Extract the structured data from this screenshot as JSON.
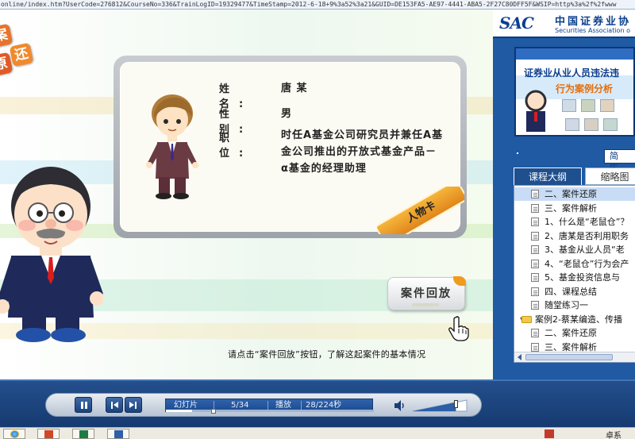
{
  "browser": {
    "url": "online/index.htm?UserCode=276812&CourseNo=336&TrainLogID=19329477&TimeStamp=2012-6-18+9%3a52%3a21&GUID=DE153FA5-AE97-4441-ABA5-2F27C80DFF5F&WSIP=http%3a%2f%2fwww"
  },
  "badge": {
    "chars": [
      "案",
      "原",
      "还"
    ]
  },
  "profile": {
    "name_label": "姓 名:",
    "name_value": "唐 某",
    "gender_label": "性 别:",
    "gender_value": "男",
    "position_label": "职 位:",
    "position_value": "时任A基金公司研究员并兼任A基金公司推出的开放式基金产品－α基金的经理助理",
    "ribbon": "人物卡"
  },
  "replay_button": "案件回放",
  "instruction": "请点击“案件回放”按钮，了解这起案件的基本情况",
  "sidebar": {
    "org_logo": "SAC",
    "org_name_cn": "中国证券业协",
    "org_name_en": "Securities Association o",
    "thumb_title": "证券业从业人员违法违",
    "thumb_subtitle": "行为案例分析",
    "simple_button": "简 历",
    "tabs": [
      "课程大纲",
      "缩略图"
    ],
    "outline": [
      {
        "label": "二、案件还原",
        "icon": "doc-icon",
        "indent": 1,
        "selected": true
      },
      {
        "label": "三、案件解析",
        "icon": "doc-icon",
        "indent": 1
      },
      {
        "label": "1、什么是“老鼠仓”？",
        "icon": "doc-icon",
        "indent": 1
      },
      {
        "label": "2、唐某是否利用职务",
        "icon": "doc-icon",
        "indent": 1
      },
      {
        "label": "3、基金从业人员“老",
        "icon": "doc-icon",
        "indent": 1
      },
      {
        "label": "4、“老鼠仓”行为会产",
        "icon": "doc-icon",
        "indent": 1
      },
      {
        "label": "5、基金投资信息与",
        "icon": "doc-icon",
        "indent": 1
      },
      {
        "label": "四、课程总结",
        "icon": "doc-icon",
        "indent": 1
      },
      {
        "label": "随堂练习一",
        "icon": "doc-icon",
        "indent": 1
      },
      {
        "label": "案例2-蔡某编造、传播",
        "icon": "folder-icon",
        "indent": 0
      },
      {
        "label": "二、案件还原",
        "icon": "doc-icon",
        "indent": 1
      },
      {
        "label": "三、案件解析",
        "icon": "doc-icon",
        "indent": 1
      }
    ]
  },
  "player": {
    "mode_label": "幻灯片",
    "slide_counter": "5/34",
    "state_label": "播放",
    "time_counter": "28/224秒",
    "progress": 0.125,
    "volume": 0.8
  },
  "taskbar": {
    "tray_text": "卓系"
  }
}
